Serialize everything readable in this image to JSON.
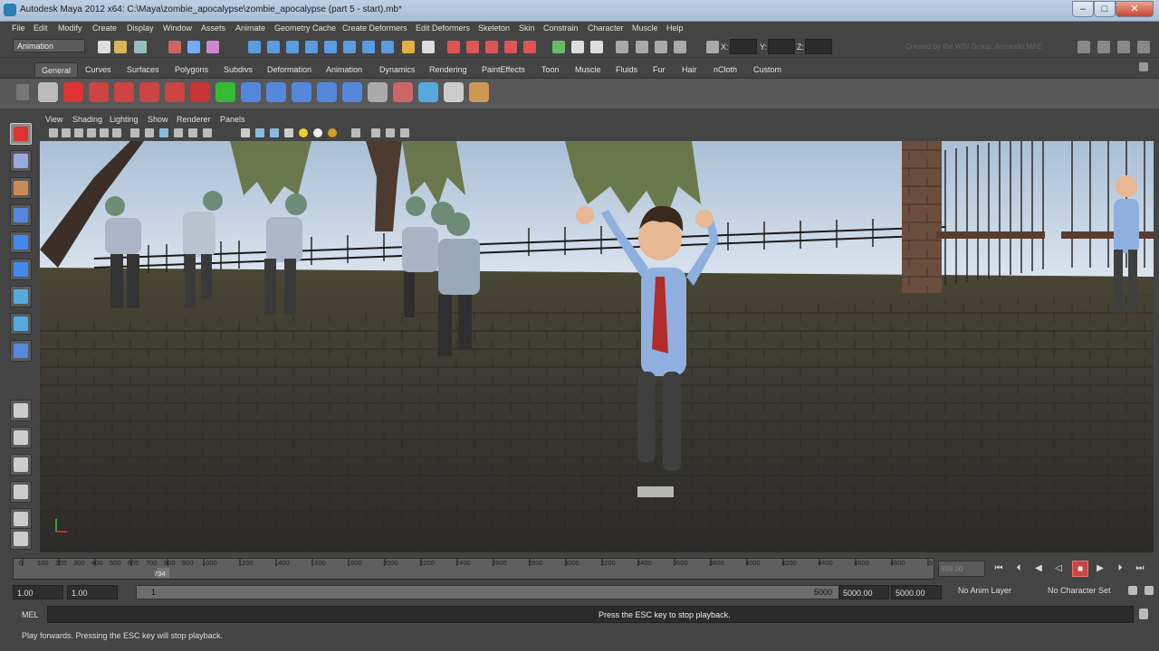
{
  "window": {
    "title": "Autodesk Maya 2012 x64: C:\\Maya\\zombie_apocalypse\\zombie_apocalypse (part 5 - start).mb*",
    "min_label": "–",
    "max_label": "□",
    "close_label": "✕"
  },
  "menus": [
    "File",
    "Edit",
    "Modify",
    "Create",
    "Display",
    "Window",
    "Assets",
    "Animate",
    "Geometry Cache",
    "Create Deformers",
    "Edit Deformers",
    "Skeleton",
    "Skin",
    "Constrain",
    "Character",
    "Muscle",
    "Help"
  ],
  "status": {
    "mode": "Animation",
    "x_label": "X:",
    "y_label": "Y:",
    "z_label": "Z:",
    "watermark": "Created by the WIN Group. Armando MAE"
  },
  "shelf_tabs": [
    "General",
    "Curves",
    "Surfaces",
    "Polygons",
    "Subdivs",
    "Deformation",
    "Animation",
    "Dynamics",
    "Rendering",
    "PaintEffects",
    "Toon",
    "Muscle",
    "Fluids",
    "Fur",
    "Hair",
    "nCloth",
    "Custom"
  ],
  "panel_menu": [
    "View",
    "Shading",
    "Lighting",
    "Show",
    "Renderer",
    "Panels"
  ],
  "timeline": {
    "ticks": [
      "0",
      "100",
      "200",
      "300",
      "400",
      "500",
      "600",
      "700",
      "800",
      "900",
      "1000",
      "1200",
      "1400",
      "1600",
      "1800",
      "2000",
      "2200",
      "2400",
      "2600",
      "2800",
      "3000",
      "3200",
      "3400",
      "3600",
      "3800",
      "4000",
      "4200",
      "4400",
      "4600",
      "4800",
      "5"
    ],
    "current_frame_marker": "734",
    "current_frame": "899.00"
  },
  "range": {
    "start_time": "1.00",
    "playback_start": "1.00",
    "slider_start": "1",
    "slider_end": "5000",
    "playback_end": "5000.00",
    "end_time": "5000.00",
    "anim_layer": "No Anim Layer",
    "character_set": "No Character Set"
  },
  "command": {
    "mel_label": "MEL",
    "result": "Press the ESC key to stop playback."
  },
  "help_line": "Play forwards. Pressing the ESC key will stop playback.",
  "colors": {
    "ui_bg": "#444444",
    "stop": "#cc4444",
    "sky": "#c3d3e3",
    "ground": "#3e3a32"
  }
}
